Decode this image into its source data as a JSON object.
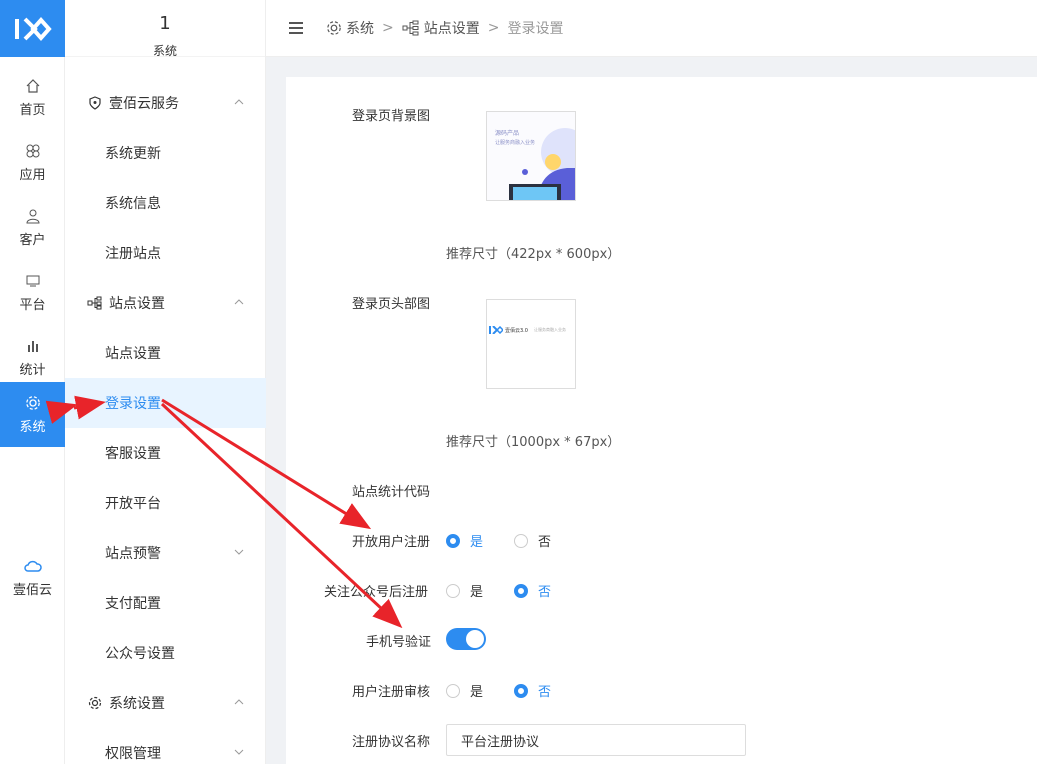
{
  "rail": {
    "items": [
      {
        "label": "首页",
        "icon": "home-icon"
      },
      {
        "label": "应用",
        "icon": "apps-icon"
      },
      {
        "label": "客户",
        "icon": "user-icon"
      },
      {
        "label": "平台",
        "icon": "monitor-icon"
      },
      {
        "label": "统计",
        "icon": "bar-chart-icon"
      },
      {
        "label": "系统",
        "icon": "gear-icon",
        "active": true
      }
    ],
    "cloud_label": "壹佰云"
  },
  "submenu": {
    "header_num": "1",
    "header_label": "系统",
    "groups": [
      {
        "label": "壹佰云服务",
        "items": [
          "系统更新",
          "系统信息",
          "注册站点"
        ]
      },
      {
        "label": "站点设置",
        "items": [
          "站点设置",
          "登录设置",
          "客服设置",
          "开放平台",
          "站点预警",
          "支付配置",
          "公众号设置"
        ]
      },
      {
        "label": "系统设置",
        "items": [
          "权限管理"
        ]
      }
    ]
  },
  "breadcrumb": {
    "items": [
      "系统",
      "站点设置",
      "登录设置"
    ]
  },
  "form": {
    "bg_label": "登录页背景图",
    "bg_thumb_line1": "源码产品",
    "bg_thumb_line2": "让服务商融入业务",
    "bg_hint": "推荐尺寸（422px * 600px）",
    "head_label": "登录页头部图",
    "head_thumb_brand": "壹佰云3.0",
    "head_thumb_tag": "让服务商融入业务",
    "head_hint": "推荐尺寸（1000px * 67px）",
    "stats_label": "站点统计代码",
    "open_reg_label": "开放用户注册",
    "follow_reg_label": "关注公众号后注册",
    "phone_verify_label": "手机号验证",
    "reg_review_label": "用户注册审核",
    "agreement_label": "注册协议名称",
    "agreement_value": "平台注册协议",
    "yes": "是",
    "no": "否"
  },
  "colors": {
    "accent": "#2d8cf0",
    "arrow": "#e8242a"
  }
}
